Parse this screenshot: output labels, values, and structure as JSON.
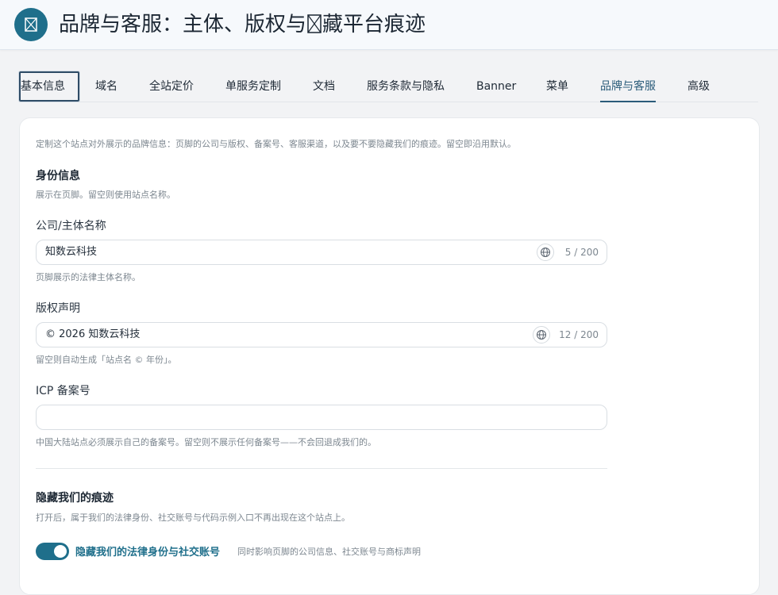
{
  "header": {
    "title": "品牌与客服：主体、版权与\u0000藏平台痕迹"
  },
  "tabs": [
    {
      "label": "基本信息"
    },
    {
      "label": "域名"
    },
    {
      "label": "全站定价"
    },
    {
      "label": "单服务定制"
    },
    {
      "label": "文档"
    },
    {
      "label": "服务条款与隐私"
    },
    {
      "label": "Banner"
    },
    {
      "label": "菜单"
    },
    {
      "label": "品牌与客服"
    },
    {
      "label": "高级"
    }
  ],
  "intro": "定制这个站点对外展示的品牌信息：页脚的公司与版权、备案号、客服渠道，以及要不要隐藏我们的痕迹。留空即沿用默认。",
  "identity": {
    "title": "身份信息",
    "desc": "展示在页脚。留空则使用站点名称。"
  },
  "company": {
    "label": "公司/主体名称",
    "value": "知数云科技",
    "counter": "5 / 200",
    "help": "页脚展示的法律主体名称。"
  },
  "copyright": {
    "label": "版权声明",
    "value": "© 2026 知数云科技",
    "counter": "12 / 200",
    "help": "留空则自动生成「站点名 © 年份」。"
  },
  "icp": {
    "label": "ICP 备案号",
    "value": "",
    "help": "中国大陆站点必须展示自己的备案号。留空则不展示任何备案号——不会回退成我们的。"
  },
  "hide": {
    "title": "隐藏我们的痕迹",
    "desc": "打开后，属于我们的法律身份、社交账号与代码示例入口不再出现在这个站点上。",
    "toggle_label": "隐藏我们的法律身份与社交账号",
    "toggle_desc": "同时影响页脚的公司信息、社交账号与商标声明"
  },
  "colors": {
    "accent": "#1f6f8b",
    "active_tab": "#2b5c7a"
  }
}
